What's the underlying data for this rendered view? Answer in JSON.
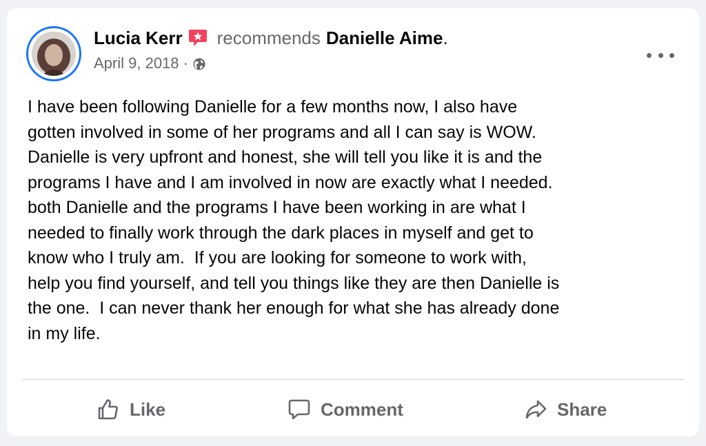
{
  "post": {
    "author": "Lucia Kerr",
    "verb": "recommends",
    "page_name": "Danielle Aime",
    "page_name_suffix": ".",
    "date": "April 9, 2018",
    "date_separator": "·",
    "visibility_icon": "globe-icon",
    "author_badge_icon": "recommend-star-icon",
    "menu_icon": "more-options-icon",
    "text": "I have been following Danielle for a few months now, I also have\ngotten involved in some of her programs and all I can say is WOW.\nDanielle is very upfront and honest, she will tell you like it is and the\nprograms I have and I am involved in now are exactly what I needed.\nboth Danielle and the programs I have been working in are what I\nneeded to finally work through the dark places in myself and get to\nknow who I truly am.  If you are looking for someone to work with,\nhelp you find yourself, and tell you things like they are then Danielle is\nthe one.  I can never thank her enough for what she has already done\nin my life."
  },
  "actions": {
    "like_label": "Like",
    "comment_label": "Comment",
    "share_label": "Share"
  },
  "colors": {
    "accent": "#1877f2",
    "badge": "#f3425f",
    "secondary_text": "#65676b",
    "primary_text": "#050505",
    "background": "#f0f2f5"
  }
}
